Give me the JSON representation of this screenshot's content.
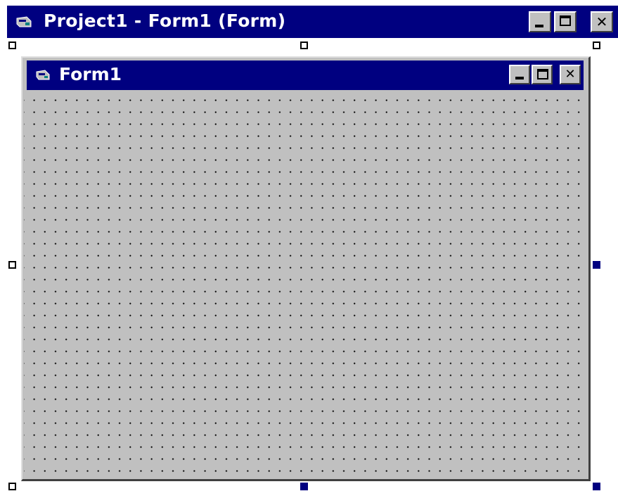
{
  "outer_window": {
    "title": "Project1 - Form1 (Form)",
    "icon": "form-icon",
    "controls": {
      "minimize_icon": "minimize-icon",
      "maximize_icon": "maximize-icon",
      "close_glyph": "✕"
    }
  },
  "form": {
    "title": "Form1",
    "icon": "form-icon",
    "controls": {
      "minimize_icon": "minimize-icon",
      "maximize_icon": "maximize-icon",
      "close_glyph": "✕"
    },
    "grid": "dot-grid"
  },
  "colors": {
    "titlebar": "#000080",
    "face": "#c0c0c0",
    "desktop": "#7b9ad6",
    "handle_active": "#000080"
  }
}
